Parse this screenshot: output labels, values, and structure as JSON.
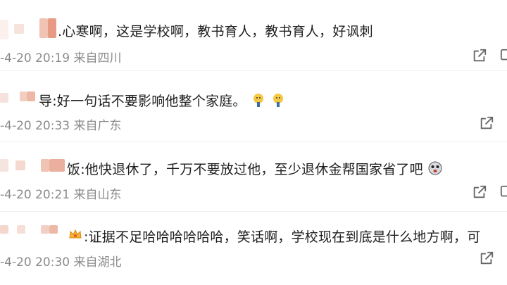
{
  "comments": [
    {
      "text": ".心寒啊，这是学校啊，教书育人，教书育人，好讽刺",
      "meta": "-4-20 20:19 来自四川",
      "share_icon": "share-icon"
    },
    {
      "text": "导:好一句话不要影响他整个家庭。",
      "meta": "-4-20 20:33 来自广东",
      "share_icon": "share-icon",
      "emojis": [
        "thinking-emoji",
        "thinking-emoji"
      ]
    },
    {
      "text": "饭:他快退休了，千万不要放过他，至少退休金帮国家省了吧",
      "meta": "-4-20 20:21 来自山东",
      "share_icon": "share-icon",
      "emojis": [
        "surprised-emoji"
      ]
    },
    {
      "text": ":证据不足哈哈哈哈哈哈，笑话啊，学校现在到底是什么地方啊，可",
      "meta": "-4-20 20:30 来自湖北",
      "share_icon": "share-icon",
      "badge": "crown-badge-icon"
    }
  ],
  "colors": {
    "text": "#1f1f1f",
    "meta": "#8a8a8a",
    "blur_light": "#f5ddd6",
    "blur_mid": "#eeb8a6",
    "blur_dark": "#e89b84"
  }
}
